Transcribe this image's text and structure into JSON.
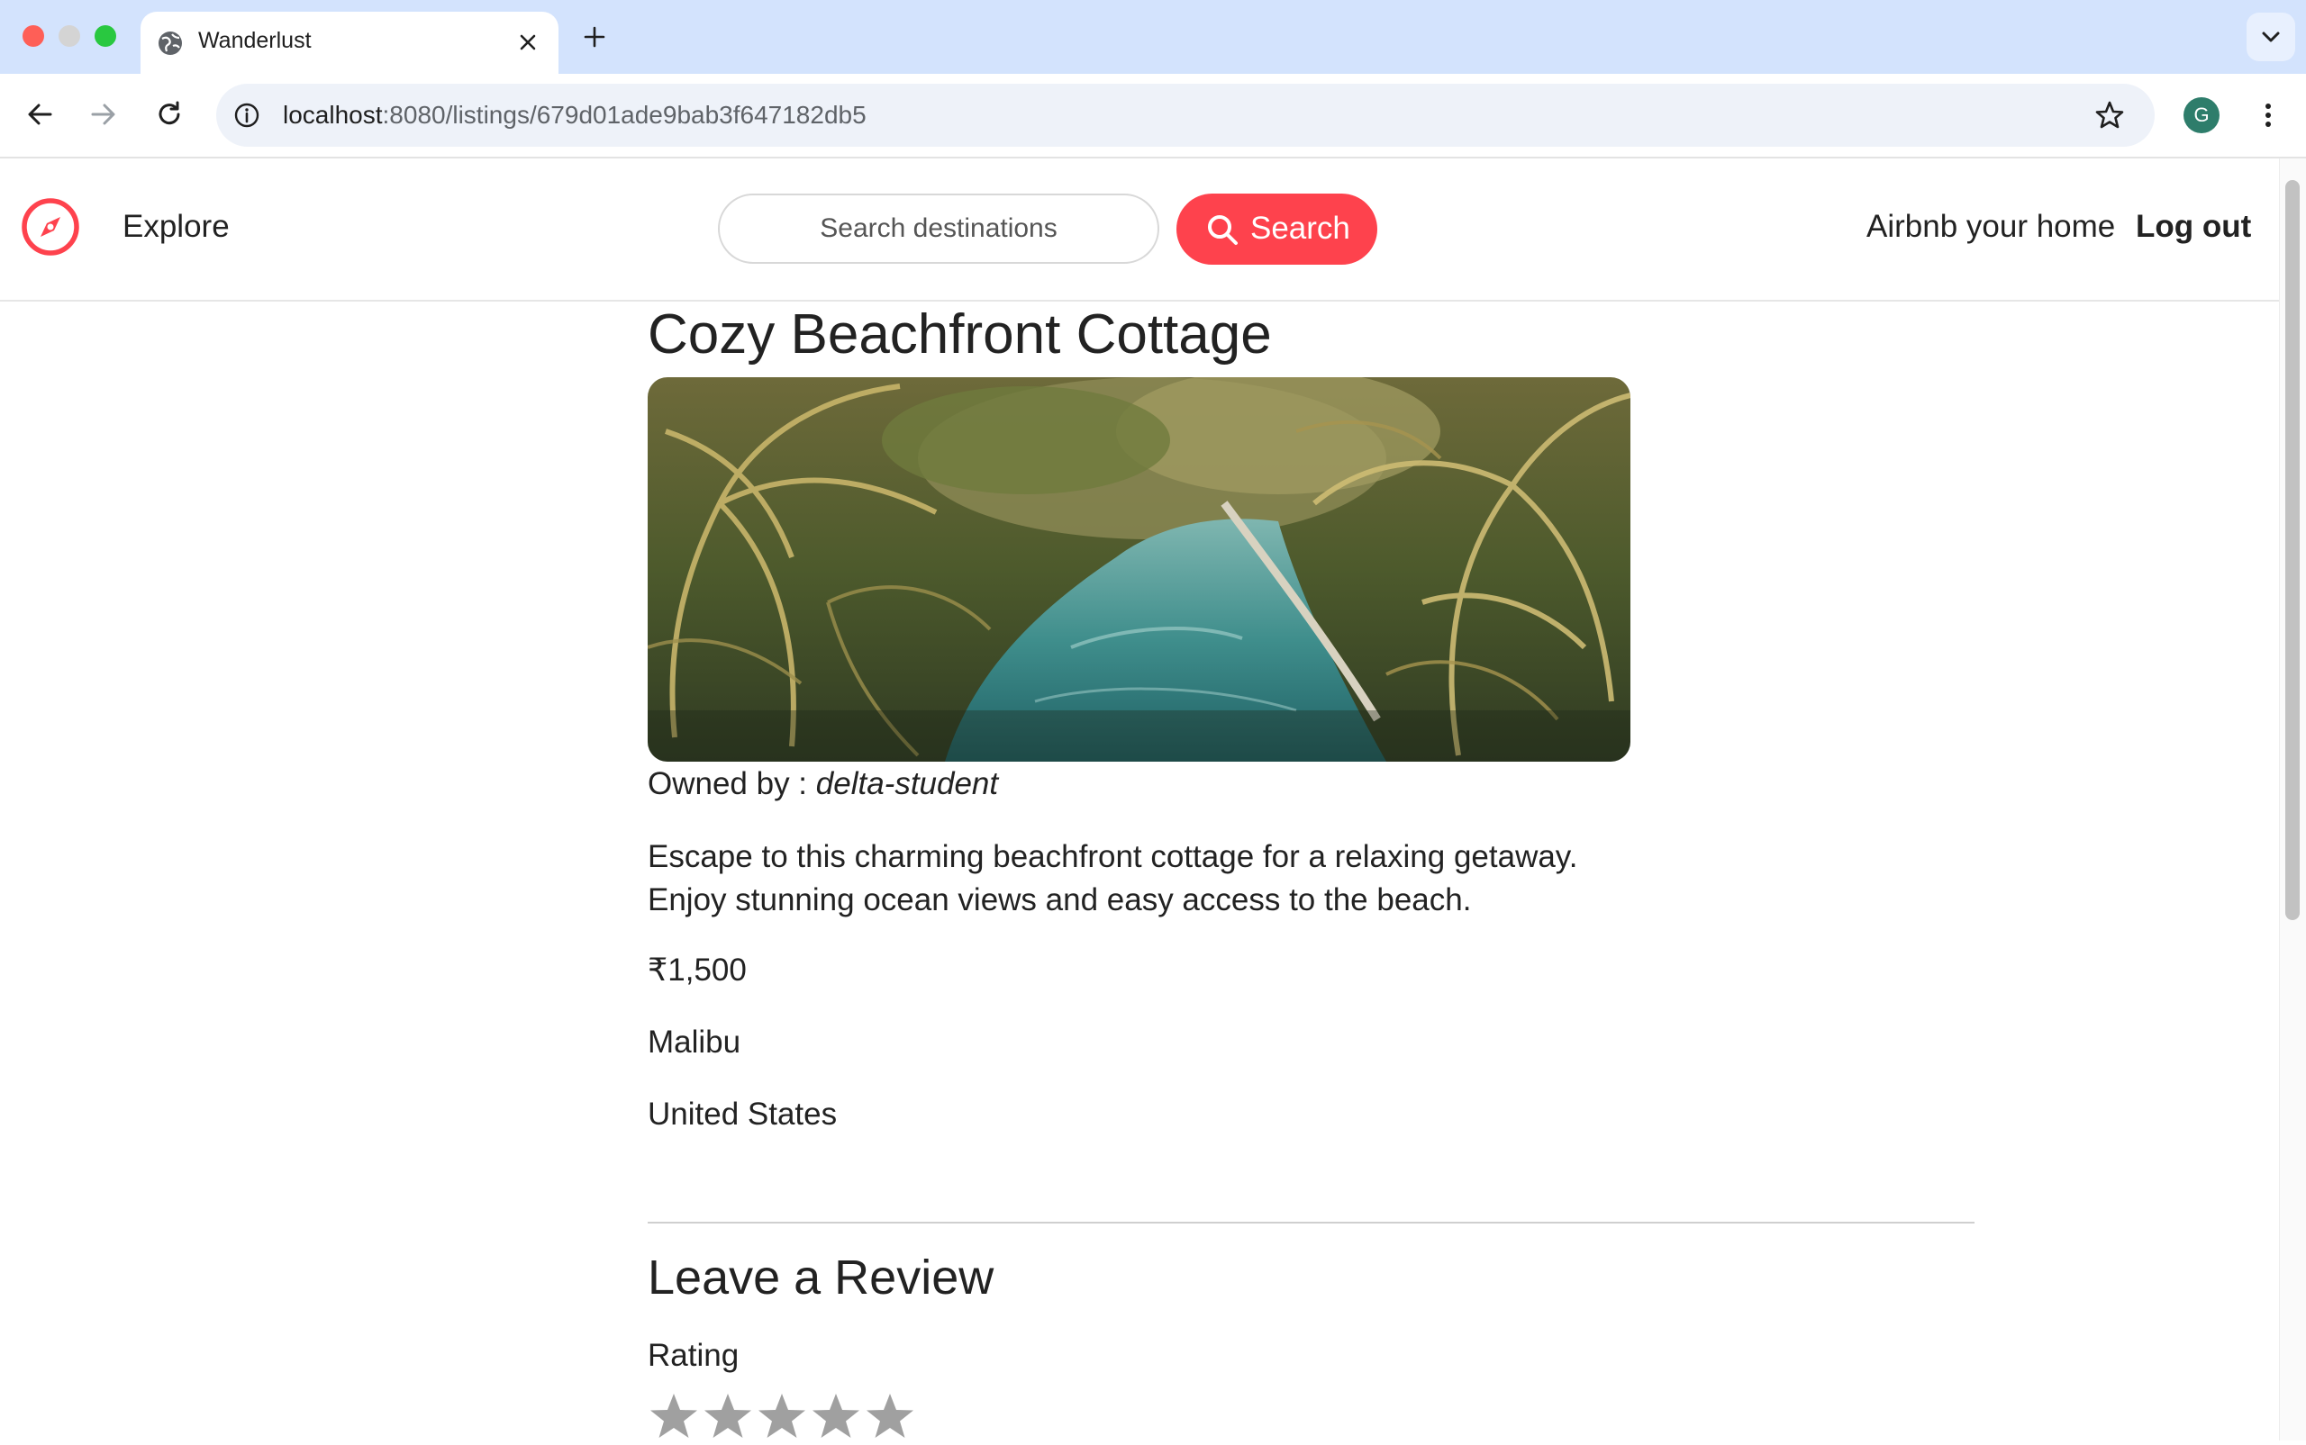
{
  "browser": {
    "tab_title": "Wanderlust",
    "url_host": "localhost",
    "url_rest": ":8080/listings/679d01ade9bab3f647182db5",
    "avatar_letter": "G"
  },
  "navbar": {
    "brand_icon": "compass-icon",
    "explore_label": "Explore",
    "search_placeholder": "Search destinations",
    "search_button_label": "Search",
    "host_link_label": "Airbnb your home",
    "logout_label": "Log out",
    "accent_color": "#fe424d"
  },
  "listing": {
    "title": "Cozy Beachfront Cottage",
    "image_icon": "tropical-lagoon-photo",
    "owner_prefix": "Owned by : ",
    "owner_name": "delta-student",
    "description_line1": "Escape to this charming beachfront cottage for a relaxing getaway.",
    "description_line2": "Enjoy stunning ocean views and easy access to the beach.",
    "price": "₹1,500",
    "location": "Malibu",
    "country": "United States"
  },
  "review": {
    "heading": "Leave a Review",
    "rating_label": "Rating",
    "star_count": 5,
    "star_color": "#a0a0a0"
  }
}
